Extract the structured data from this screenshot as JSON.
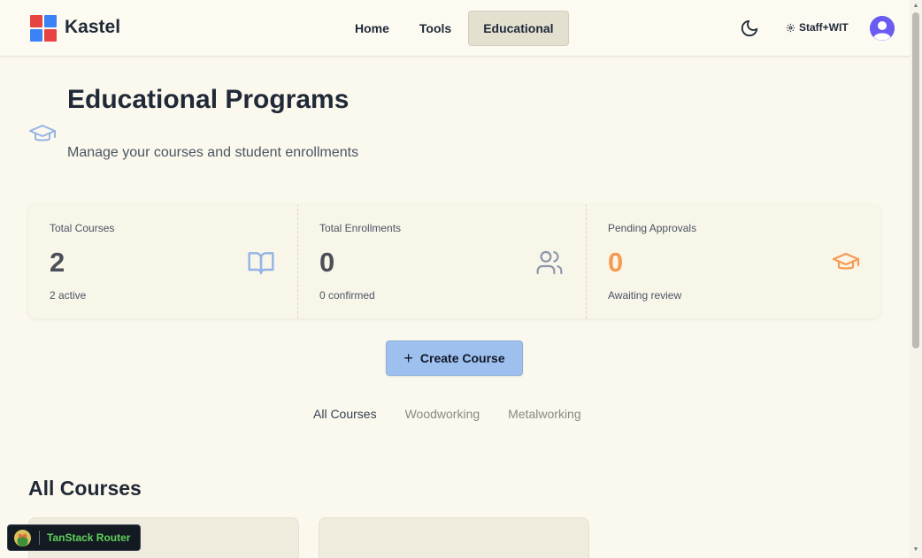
{
  "header": {
    "brand": "Kastel",
    "nav": [
      {
        "label": "Home",
        "active": false
      },
      {
        "label": "Tools",
        "active": false
      },
      {
        "label": "Educational",
        "active": true
      }
    ],
    "theme_icon": "moon-icon",
    "staff_label": "Staff+WIT",
    "logo_colors": [
      "#e84343",
      "#3b82f6",
      "#3b82f6",
      "#e84343"
    ]
  },
  "page": {
    "title": "Educational Programs",
    "subtitle": "Manage your courses and student enrollments",
    "title_icon": "graduation-cap-icon"
  },
  "stats": [
    {
      "label": "Total Courses",
      "value": "2",
      "desc": "2 active",
      "icon": "book-open-icon",
      "color": "#93b4e6"
    },
    {
      "label": "Total Enrollments",
      "value": "0",
      "desc": "0 confirmed",
      "icon": "users-icon",
      "color": "#8a94a8"
    },
    {
      "label": "Pending Approvals",
      "value": "0",
      "desc": "Awaiting review",
      "icon": "graduation-cap-icon",
      "color": "#f79a52"
    }
  ],
  "create_button": {
    "icon": "plus-icon",
    "label": "Create Course"
  },
  "filters": [
    {
      "label": "All Courses",
      "active": true
    },
    {
      "label": "Woodworking",
      "active": false
    },
    {
      "label": "Metalworking",
      "active": false
    }
  ],
  "section": {
    "title": "All Courses"
  },
  "devtools": {
    "label": "TanStack Router"
  }
}
